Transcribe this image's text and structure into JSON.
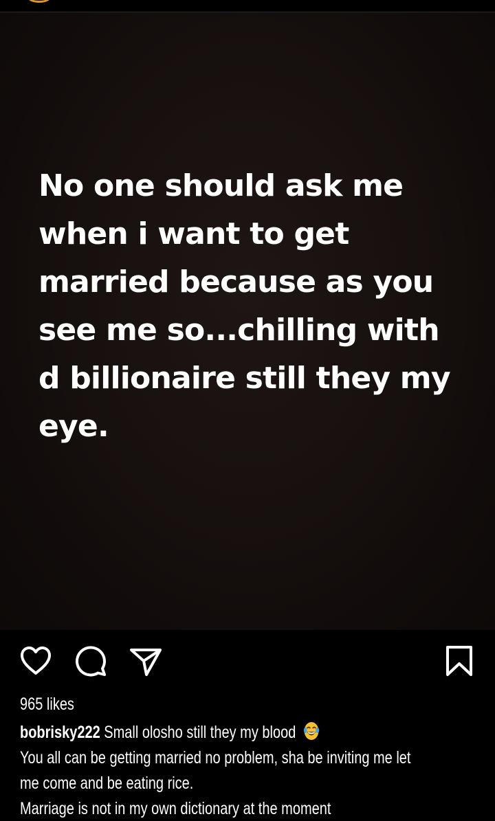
{
  "post": {
    "image_text": "No one should ask me\nwhen i want to get\nmarried because as you\nsee me so...chilling with\nd billionaire still they my\neye."
  },
  "actions": {
    "like_icon": "heart-icon",
    "comment_icon": "comment-icon",
    "share_icon": "paper-plane-icon",
    "save_icon": "bookmark-icon"
  },
  "likes": "965 likes",
  "caption": {
    "username": "bobrisky222",
    "text": "Small olosho still they my blood",
    "emoji": "face-with-tears-of-joy",
    "line2": "You all can be getting married no problem, sha be inviting me let",
    "line3": "me come and be eating rice.",
    "line4": "Marriage is not in my own dictionary at the moment"
  },
  "colors": {
    "background": "#000000",
    "text": "#ffffff",
    "avatar_ring": "#e0952a",
    "emoji_face": "#f5c033"
  }
}
